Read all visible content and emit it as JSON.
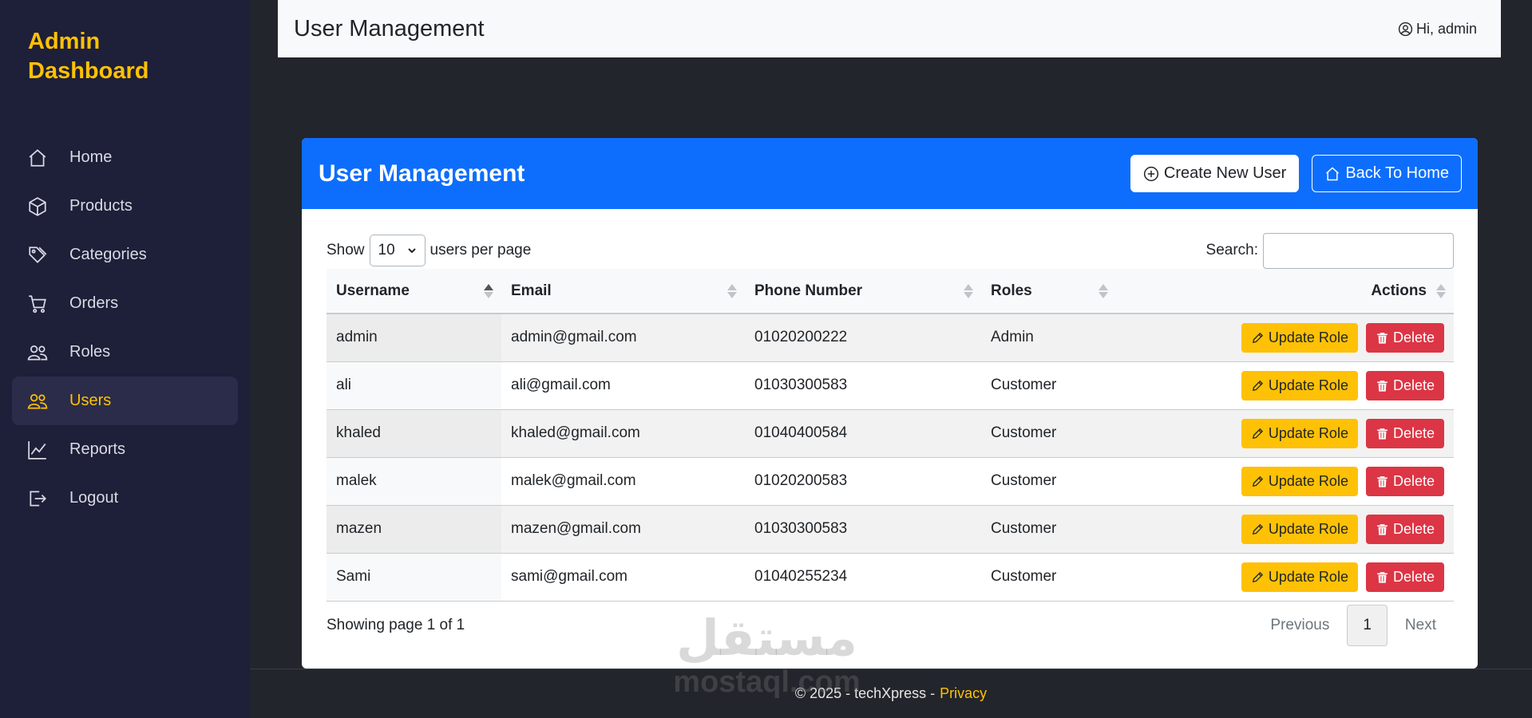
{
  "sidebar": {
    "brand": "Admin Dashboard",
    "brand_line1": "Admin",
    "brand_line2": "Dashboard",
    "items": [
      {
        "label": "Home",
        "icon": "home-icon"
      },
      {
        "label": "Products",
        "icon": "box-icon"
      },
      {
        "label": "Categories",
        "icon": "tags-icon"
      },
      {
        "label": "Orders",
        "icon": "cart-icon"
      },
      {
        "label": "Roles",
        "icon": "people-icon"
      },
      {
        "label": "Users",
        "icon": "people-icon",
        "active": true
      },
      {
        "label": "Reports",
        "icon": "chart-line-icon"
      },
      {
        "label": "Logout",
        "icon": "logout-icon"
      }
    ],
    "accent": "#fec106"
  },
  "topbar": {
    "title": "User Management",
    "greeting": "Hi, admin"
  },
  "card": {
    "title": "User Management",
    "create_label": "Create New User",
    "back_label": "Back To Home",
    "header_color": "#0d6efd"
  },
  "controls": {
    "show_label": "Show",
    "per_page_value": "10",
    "per_page_suffix": "users per page",
    "search_label": "Search:",
    "search_value": ""
  },
  "table": {
    "columns": [
      "Username",
      "Email",
      "Phone Number",
      "Roles",
      "Actions"
    ],
    "update_label": "Update Role",
    "delete_label": "Delete",
    "rows": [
      {
        "username": "admin",
        "email": "admin@gmail.com",
        "phone": "01020200222",
        "role": "Admin"
      },
      {
        "username": "ali",
        "email": "ali@gmail.com",
        "phone": "01030300583",
        "role": "Customer"
      },
      {
        "username": "khaled",
        "email": "khaled@gmail.com",
        "phone": "01040400584",
        "role": "Customer"
      },
      {
        "username": "malek",
        "email": "malek@gmail.com",
        "phone": "01020200583",
        "role": "Customer"
      },
      {
        "username": "mazen",
        "email": "mazen@gmail.com",
        "phone": "01030300583",
        "role": "Customer"
      },
      {
        "username": "Sami",
        "email": "sami@gmail.com",
        "phone": "01040255234",
        "role": "Customer"
      }
    ]
  },
  "pagination": {
    "info": "Showing page 1 of 1",
    "previous": "Previous",
    "current": "1",
    "next": "Next"
  },
  "footer": {
    "text": "© 2025 - techXpress -",
    "privacy": "Privacy"
  },
  "watermark": {
    "arabic": "مستقل",
    "latin": "mostaql.com"
  }
}
